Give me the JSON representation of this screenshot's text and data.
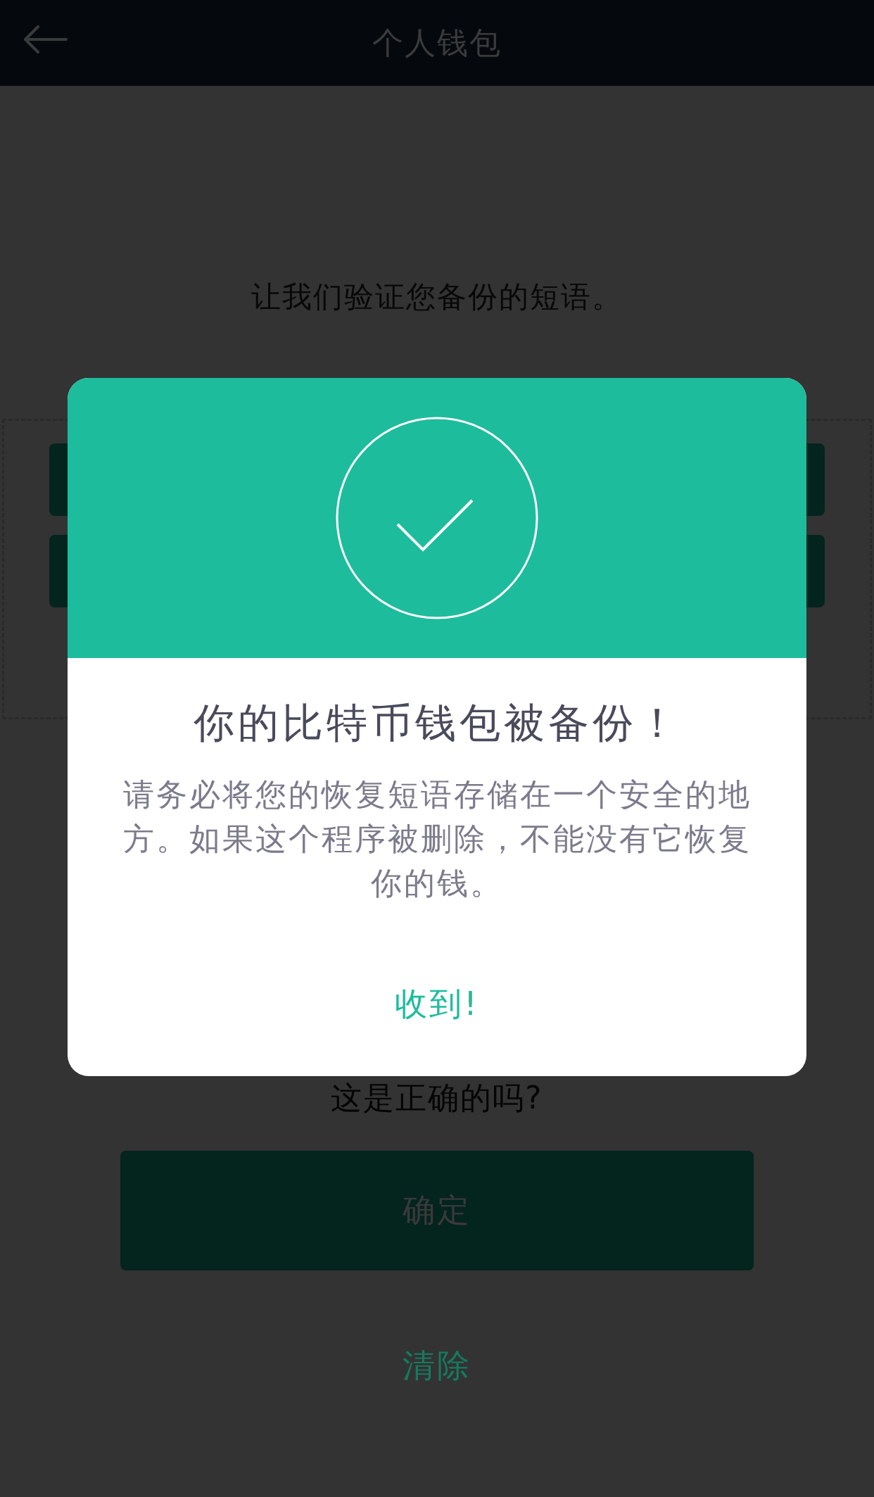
{
  "header": {
    "title": "个人钱包"
  },
  "instruction": "让我们验证您备份的短语。",
  "question": "这是正确的吗?",
  "confirm_button": {
    "label": "确定",
    "disabled": true
  },
  "clear_button": "清除",
  "dialog": {
    "title": "你的比特币钱包被备份！",
    "message": "请务必将您的恢复短语存储在一个安全的地方。如果这个程序被删除，不能没有它恢复你的钱。",
    "button": "收到!"
  }
}
